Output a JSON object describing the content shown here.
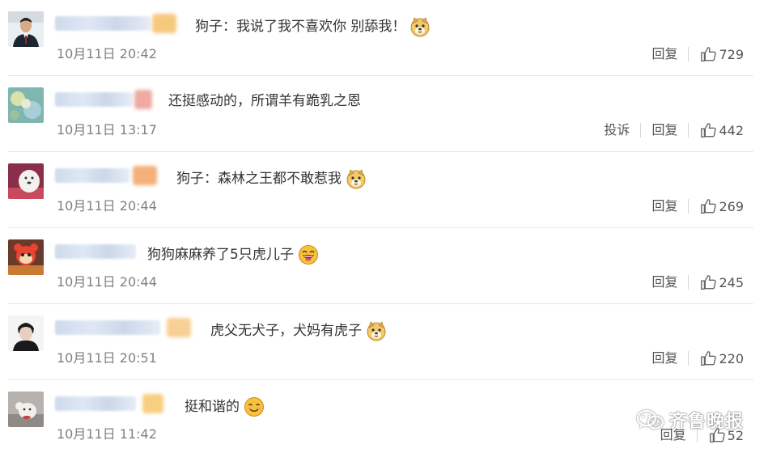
{
  "comments": [
    {
      "text": "狗子：我说了我不喜欢你 别舔我！",
      "emoji": "doge-emoji",
      "time": "10月11日 20:42",
      "report": "",
      "reply": "回复",
      "likes": "729"
    },
    {
      "text": "还挺感动的，所谓羊有跪乳之恩",
      "emoji": "",
      "time": "10月11日 13:17",
      "report": "投诉",
      "reply": "回复",
      "likes": "442"
    },
    {
      "text": "狗子：森林之王都不敢惹我",
      "emoji": "doge-emoji",
      "time": "10月11日 20:44",
      "report": "",
      "reply": "回复",
      "likes": "269"
    },
    {
      "text": "狗狗麻麻养了5只虎儿子",
      "emoji": "laughing-emoji",
      "time": "10月11日 20:44",
      "report": "",
      "reply": "回复",
      "likes": "245"
    },
    {
      "text": "虎父无犬子，犬妈有虎子",
      "emoji": "doge-emoji",
      "time": "10月11日 20:51",
      "report": "",
      "reply": "回复",
      "likes": "220"
    },
    {
      "text": "挺和谐的",
      "emoji": "smile-emoji",
      "time": "10月11日 11:42",
      "report": "",
      "reply": "回复",
      "likes": "52"
    }
  ],
  "watermark": {
    "text": "齐鲁晚报",
    "icon": "wechat-icon"
  }
}
